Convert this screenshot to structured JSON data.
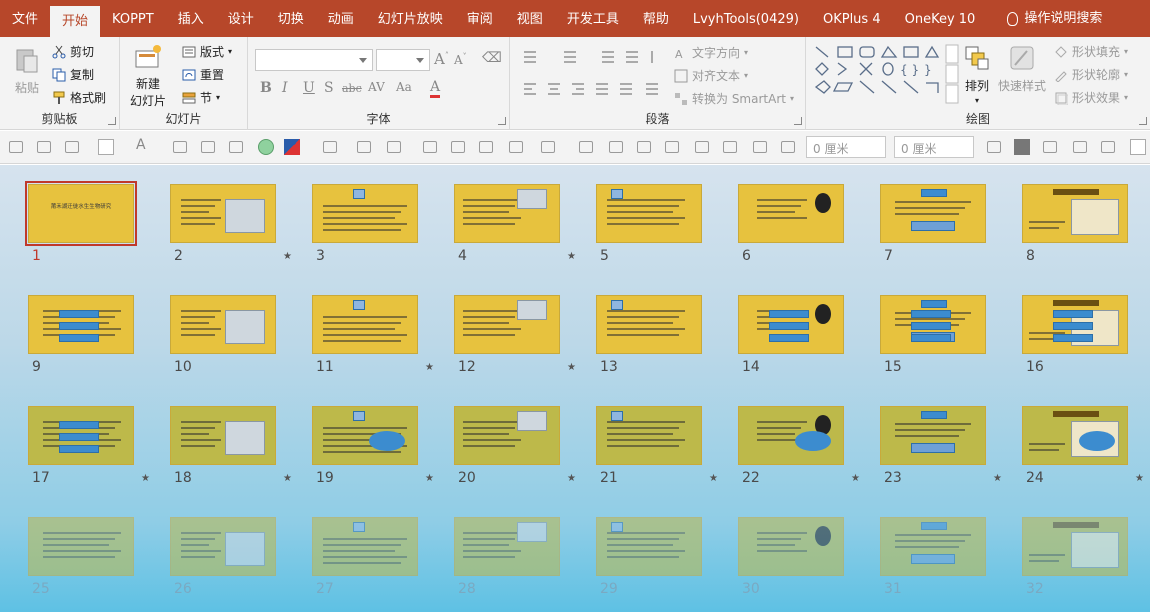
{
  "menu": {
    "tabs": [
      "文件",
      "开始",
      "KOPPT",
      "插入",
      "设计",
      "切换",
      "动画",
      "幻灯片放映",
      "审阅",
      "视图",
      "开发工具",
      "帮助",
      "LvyhTools(0429)",
      "OKPlus 4",
      "OneKey 10"
    ],
    "active_tab": "开始",
    "search_label": "操作说明搜索"
  },
  "ribbon": {
    "clipboard": {
      "label": "剪贴板",
      "paste": "粘贴",
      "cut": "剪切",
      "copy": "复制",
      "format_painter": "格式刷"
    },
    "slides": {
      "label": "幻灯片",
      "new_slide_line1": "新建",
      "new_slide_line2": "幻灯片",
      "layout": "版式",
      "reset": "重置",
      "section": "节"
    },
    "font": {
      "label": "字体",
      "font_name": "",
      "font_size": "",
      "buttons": [
        "B",
        "I",
        "U",
        "S",
        "abc",
        "AV",
        "Aa",
        "A"
      ]
    },
    "paragraph": {
      "label": "段落",
      "text_direction": "文字方向",
      "align_text": "对齐文本",
      "smartart": "转换为 SmartArt"
    },
    "drawing": {
      "label": "绘图",
      "arrange": "排列",
      "quick_styles": "快速样式",
      "shape_fill": "形状填充",
      "shape_outline": "形状轮廓",
      "shape_effects": "形状效果"
    }
  },
  "toolbar2": {
    "width_value": "0 厘米",
    "height_value": "0 厘米"
  },
  "sorter": {
    "selected_slide": 1,
    "slides": [
      {
        "n": "1",
        "star": false,
        "title": "莆禾湖迁徙水生生物研究"
      },
      {
        "n": "2",
        "star": true
      },
      {
        "n": "3",
        "star": false
      },
      {
        "n": "4",
        "star": true
      },
      {
        "n": "5",
        "star": false
      },
      {
        "n": "6",
        "star": false
      },
      {
        "n": "7",
        "star": false
      },
      {
        "n": "8",
        "star": false
      },
      {
        "n": "9",
        "star": false
      },
      {
        "n": "10",
        "star": false
      },
      {
        "n": "11",
        "star": true
      },
      {
        "n": "12",
        "star": true
      },
      {
        "n": "13",
        "star": false
      },
      {
        "n": "14",
        "star": false
      },
      {
        "n": "15",
        "star": false
      },
      {
        "n": "16",
        "star": false
      },
      {
        "n": "17",
        "star": true
      },
      {
        "n": "18",
        "star": true
      },
      {
        "n": "19",
        "star": true
      },
      {
        "n": "20",
        "star": true
      },
      {
        "n": "21",
        "star": true
      },
      {
        "n": "22",
        "star": true
      },
      {
        "n": "23",
        "star": true
      },
      {
        "n": "24",
        "star": true
      },
      {
        "n": "25",
        "star": false
      },
      {
        "n": "26",
        "star": false
      },
      {
        "n": "27",
        "star": false
      },
      {
        "n": "28",
        "star": false
      },
      {
        "n": "29",
        "star": false
      },
      {
        "n": "30",
        "star": false
      },
      {
        "n": "31",
        "star": false
      },
      {
        "n": "32",
        "star": false
      }
    ]
  },
  "colors": {
    "ribbon_accent": "#b7472a",
    "slide_bg": "#e7c23e",
    "selected_outline": "#c0392b"
  }
}
